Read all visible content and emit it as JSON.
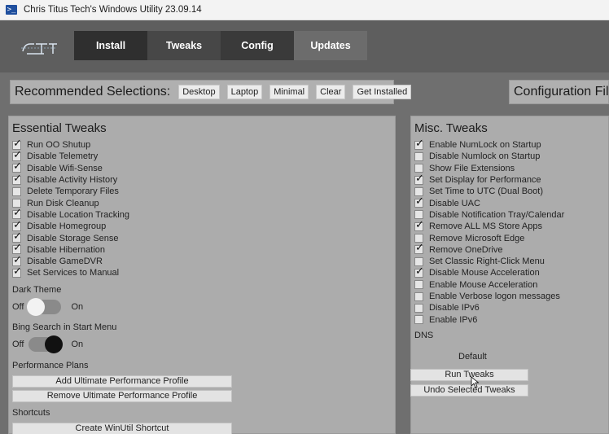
{
  "window": {
    "icon": "powershell-icon",
    "title": "Chris Titus Tech's Windows Utility 23.09.14"
  },
  "logo": {
    "text": "CTT"
  },
  "tabs": [
    {
      "label": "Install"
    },
    {
      "label": "Tweaks"
    },
    {
      "label": "Config"
    },
    {
      "label": "Updates"
    }
  ],
  "recommended": {
    "label": "Recommended Selections:",
    "buttons": [
      {
        "label": "Desktop"
      },
      {
        "label": "Laptop"
      },
      {
        "label": "Minimal"
      },
      {
        "label": "Clear"
      },
      {
        "label": "Get Installed"
      }
    ]
  },
  "config_files": {
    "label": "Configuration File"
  },
  "essential": {
    "title": "Essential Tweaks",
    "items": [
      {
        "label": "Run OO Shutup",
        "checked": true
      },
      {
        "label": "Disable Telemetry",
        "checked": true
      },
      {
        "label": "Disable Wifi-Sense",
        "checked": true
      },
      {
        "label": "Disable Activity History",
        "checked": true
      },
      {
        "label": "Delete Temporary Files",
        "checked": false
      },
      {
        "label": "Run Disk Cleanup",
        "checked": false
      },
      {
        "label": "Disable Location Tracking",
        "checked": true
      },
      {
        "label": "Disable Homegroup",
        "checked": true
      },
      {
        "label": "Disable Storage Sense",
        "checked": true
      },
      {
        "label": "Disable Hibernation",
        "checked": true
      },
      {
        "label": "Disable GameDVR",
        "checked": true
      },
      {
        "label": "Set Services to Manual",
        "checked": true
      }
    ],
    "dark_theme": {
      "label": "Dark Theme",
      "off": "Off",
      "on": "On",
      "enabled": false
    },
    "bing_search": {
      "label": "Bing Search in Start Menu",
      "off": "Off",
      "on": "On",
      "enabled": true
    },
    "performance_plans": {
      "label": "Performance Plans",
      "add": "Add Ultimate Performance Profile",
      "remove": "Remove Ultimate Performance Profile"
    },
    "shortcuts": {
      "label": "Shortcuts",
      "create": "Create WinUtil Shortcut"
    }
  },
  "misc": {
    "title": "Misc. Tweaks",
    "items": [
      {
        "label": "Enable NumLock on Startup",
        "checked": true
      },
      {
        "label": "Disable Numlock on Startup",
        "checked": false
      },
      {
        "label": "Show File Extensions",
        "checked": false
      },
      {
        "label": "Set Display for Performance",
        "checked": true
      },
      {
        "label": "Set Time to UTC (Dual Boot)",
        "checked": false
      },
      {
        "label": "Disable UAC",
        "checked": true
      },
      {
        "label": "Disable Notification Tray/Calendar",
        "checked": false
      },
      {
        "label": "Remove ALL MS Store Apps",
        "checked": true
      },
      {
        "label": "Remove Microsoft Edge",
        "checked": false
      },
      {
        "label": "Remove OneDrive",
        "checked": true
      },
      {
        "label": "Set Classic Right-Click Menu",
        "checked": false
      },
      {
        "label": "Disable Mouse Acceleration",
        "checked": true
      },
      {
        "label": "Enable Mouse Acceleration",
        "checked": false
      },
      {
        "label": "Enable Verbose logon messages",
        "checked": false
      },
      {
        "label": "Disable IPv6",
        "checked": false
      },
      {
        "label": "Enable IPv6",
        "checked": false
      }
    ],
    "dns": {
      "label": "DNS",
      "selected": "Default"
    },
    "run_tweaks": "Run Tweaks",
    "undo_tweaks": "Undo Selected Tweaks"
  }
}
